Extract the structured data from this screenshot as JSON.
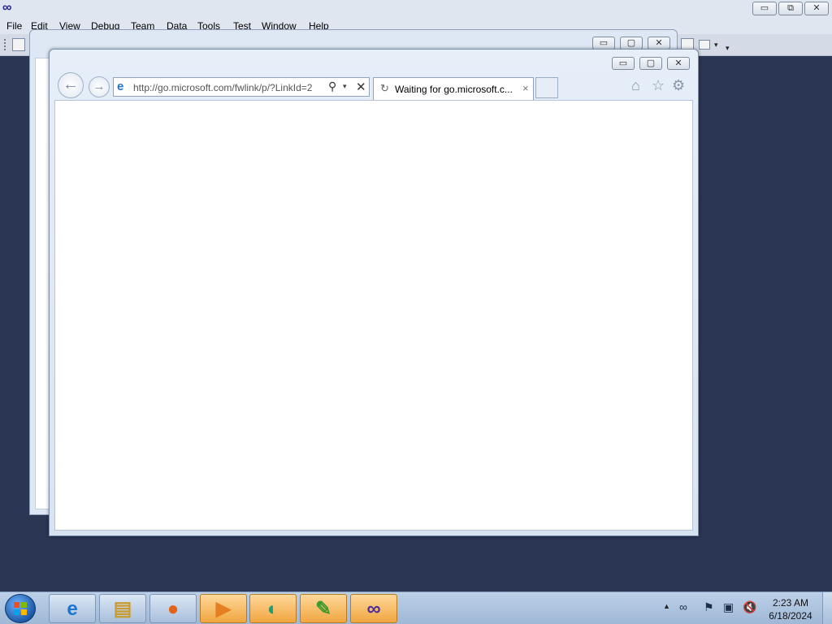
{
  "vs": {
    "logo": "∞",
    "menu": [
      "File",
      "Edit",
      "View",
      "Debug",
      "Team",
      "Data",
      "Tools",
      "Test",
      "Window",
      "Help"
    ],
    "caption": {
      "minimize": "▭",
      "restore": "⧉",
      "close": "✕"
    }
  },
  "ie_back": {
    "caption": {
      "minimize": "▭",
      "maximize": "▢",
      "close": "✕"
    }
  },
  "ie": {
    "caption": {
      "minimize": "▭",
      "maximize": "▢",
      "close": "✕"
    },
    "back_glyph": "←",
    "forward_glyph": "→",
    "address": {
      "icon": "e",
      "url": "http://go.microsoft.com/fwlink/p/?LinkId=2",
      "search_glyph": "⚲",
      "dropdown_glyph": "▾",
      "stop_glyph": "✕"
    },
    "tab": {
      "spinner_glyph": "↻",
      "title": "Waiting for go.microsoft.c...",
      "close_glyph": "×"
    },
    "commands": {
      "home": "⌂",
      "favorites": "☆",
      "tools": "⚙"
    }
  },
  "taskbar": {
    "pinned": [
      {
        "name": "internet-explorer-icon",
        "glyph": "e",
        "color": "#1f74d0",
        "active": false
      },
      {
        "name": "file-explorer-icon",
        "glyph": "▤",
        "color": "#c99a2e",
        "active": false
      },
      {
        "name": "firefox-icon",
        "glyph": "●",
        "color": "#e3621a",
        "active": false
      },
      {
        "name": "media-player-icon",
        "glyph": "▶",
        "color": "#e67e22",
        "active": true
      },
      {
        "name": "remote-app-icon",
        "glyph": "◐",
        "color": "#1a9e7a",
        "active": true
      },
      {
        "name": "notepad-icon",
        "glyph": "✎",
        "color": "#3e9a2a",
        "active": true
      },
      {
        "name": "visual-studio-icon",
        "glyph": "∞",
        "color": "#4a2c9e",
        "active": true
      }
    ],
    "tray": {
      "arrow": "▲",
      "icons": [
        "∞",
        "⚑",
        "▣",
        "🔇"
      ]
    },
    "clock": {
      "time": "2:23 AM",
      "date": "6/18/2024"
    }
  }
}
